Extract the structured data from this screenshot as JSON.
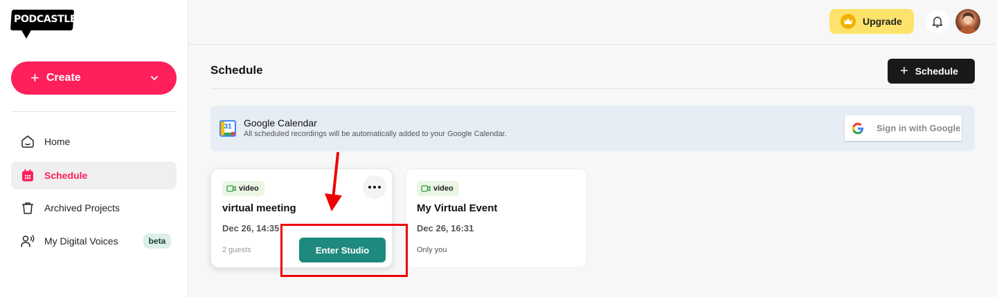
{
  "logo": {
    "text": "PODCASTLE"
  },
  "sidebar": {
    "create_label": "Create",
    "items": [
      {
        "label": "Home",
        "icon": "home-icon"
      },
      {
        "label": "Schedule",
        "icon": "calendar-icon",
        "active": true
      },
      {
        "label": "Archived Projects",
        "icon": "trash-icon"
      },
      {
        "label": "My Digital Voices",
        "icon": "voice-user-icon",
        "badge": "beta"
      }
    ]
  },
  "topbar": {
    "upgrade_label": "Upgrade"
  },
  "main": {
    "title": "Schedule",
    "schedule_button": "Schedule",
    "gcal": {
      "icon_number": "31",
      "title": "Google Calendar",
      "subtitle": "All scheduled recordings will be automatically added to your Google Calendar.",
      "signin_label": "Sign in with Google"
    },
    "cards": [
      {
        "tag": "video",
        "title": "virtual meeting",
        "date": "Dec 26, 14:35",
        "guests": "2 guests",
        "action": "Enter Studio"
      },
      {
        "tag": "video",
        "title": "My Virtual Event",
        "date": "Dec 26, 16:31",
        "guests": "Only you"
      }
    ]
  },
  "colors": {
    "brand": "#ff1f5a",
    "accent_green": "#1e8a7e",
    "upgrade": "#fde36b",
    "highlight": "#ee0000"
  }
}
